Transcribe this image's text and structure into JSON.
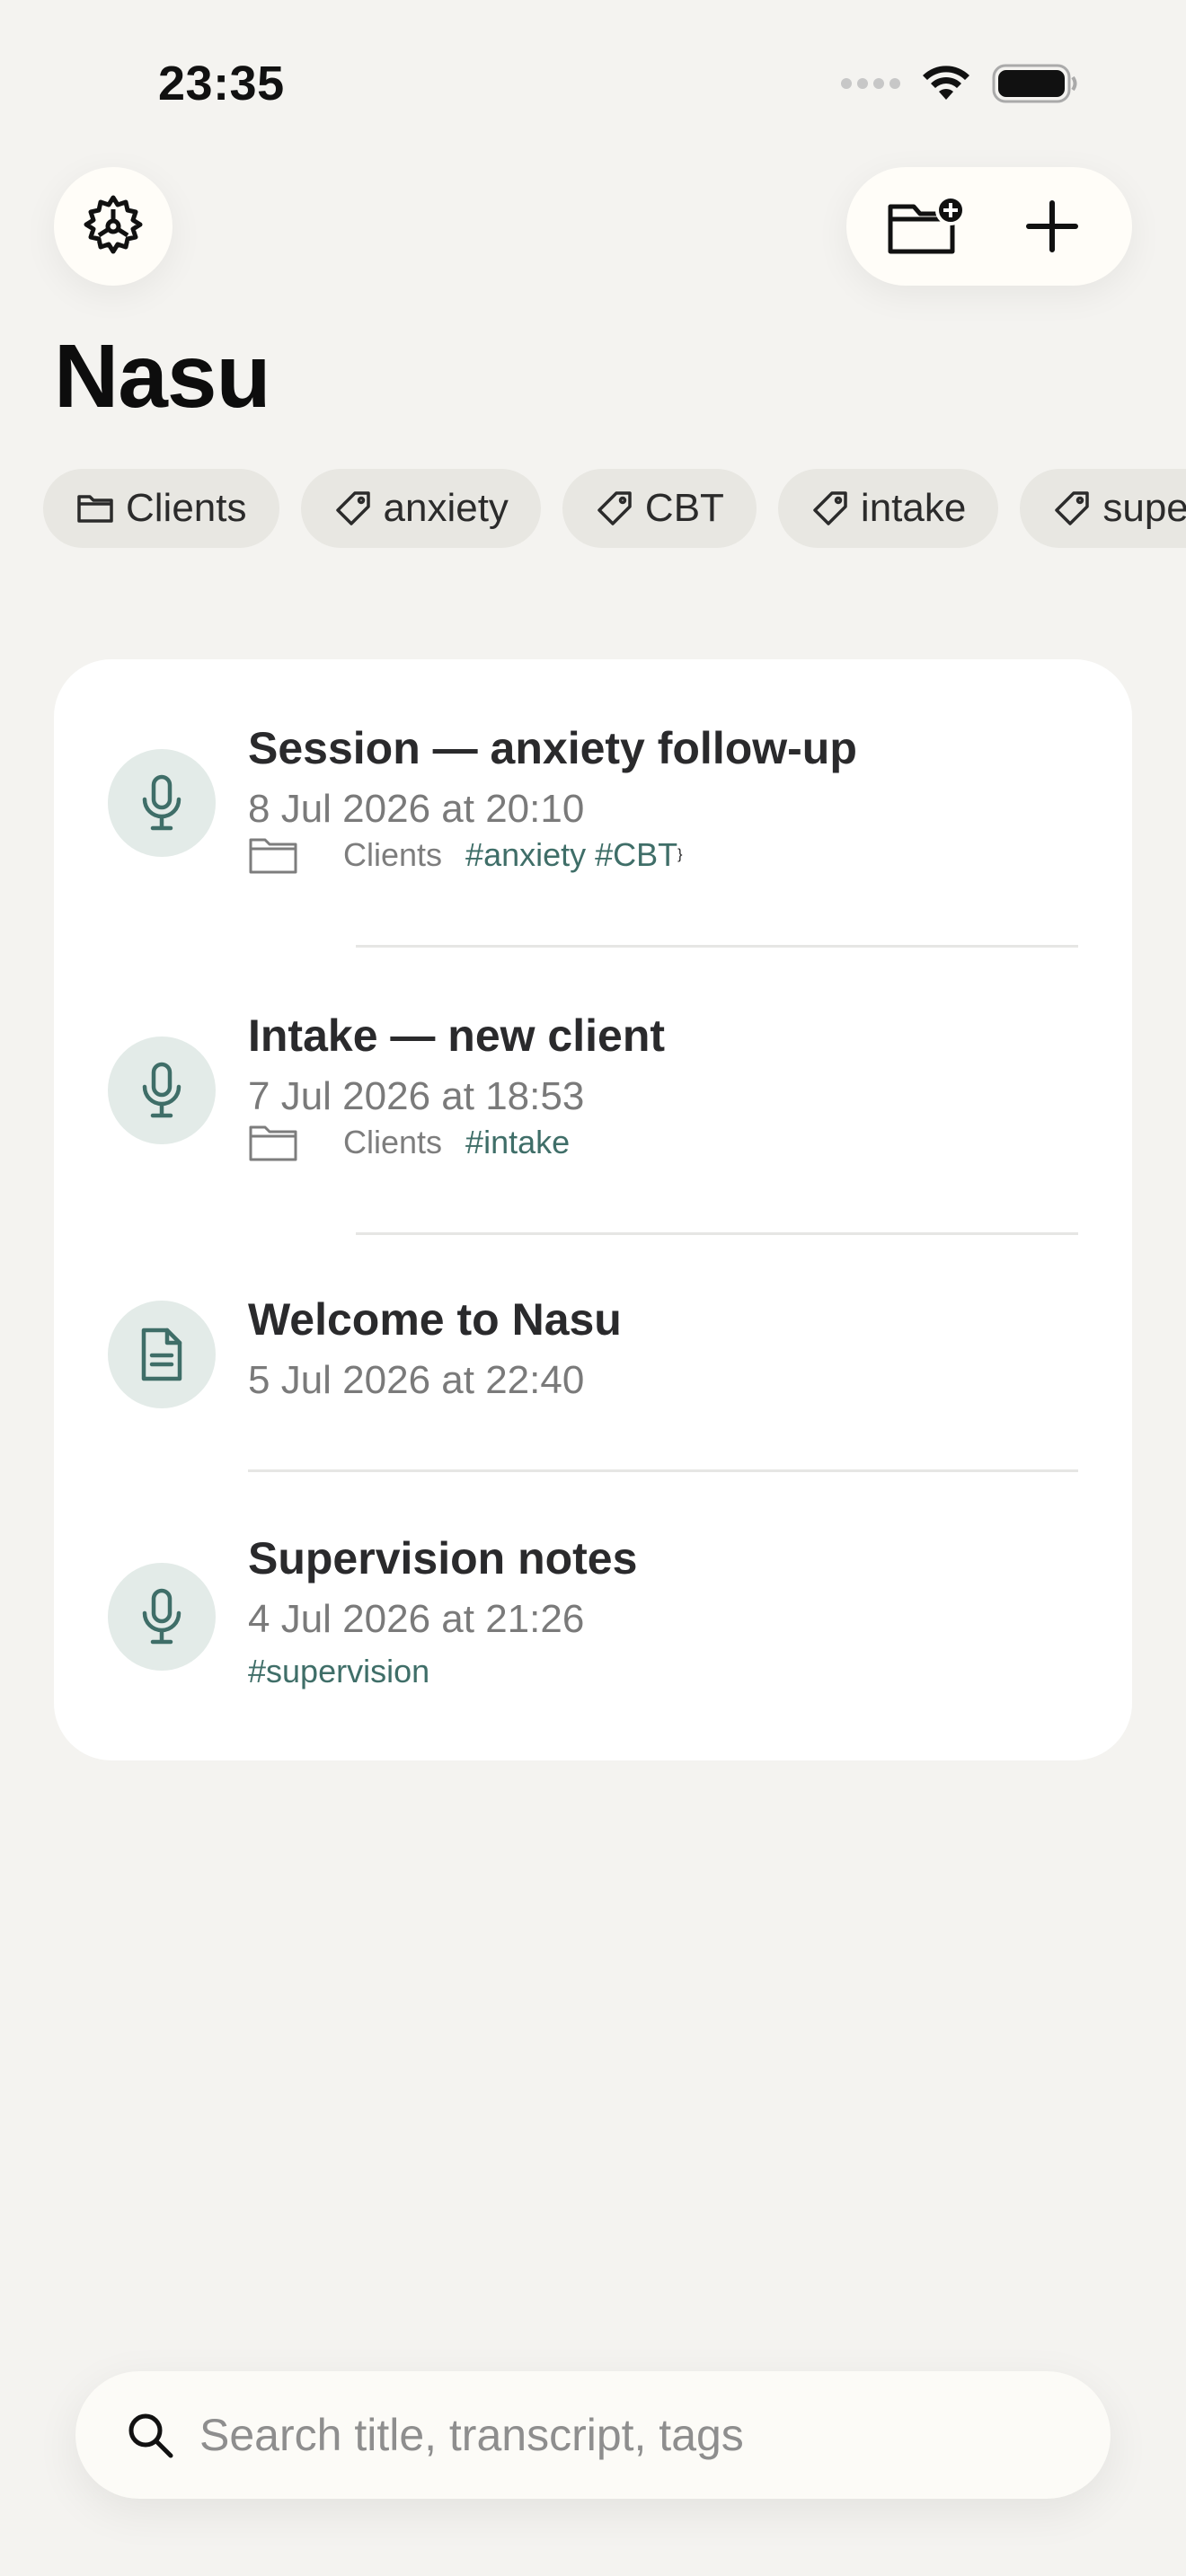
{
  "status_bar": {
    "time": "23:35"
  },
  "header": {
    "settings_icon": "gear-icon",
    "new_folder_icon": "folder-plus-icon",
    "add_icon": "plus-icon",
    "title": "Nasu"
  },
  "filters": [
    {
      "icon": "folder-icon",
      "label": "Clients"
    },
    {
      "icon": "tag-icon",
      "label": "anxiety"
    },
    {
      "icon": "tag-icon",
      "label": "CBT"
    },
    {
      "icon": "tag-icon",
      "label": "intake"
    },
    {
      "icon": "tag-icon",
      "label": "supervision"
    }
  ],
  "notes": [
    {
      "icon": "microphone-icon",
      "title": "Session — anxiety follow-up",
      "date": "8 Jul 2026 at 20:10",
      "folder": "Clients",
      "tags": "#anxiety #CBT"
    },
    {
      "icon": "microphone-icon",
      "title": "Intake — new client",
      "date": "7 Jul 2026 at 18:53",
      "folder": "Clients",
      "tags": "#intake"
    },
    {
      "icon": "document-icon",
      "title": "Welcome to Nasu",
      "date": "5 Jul 2026 at 22:40"
    },
    {
      "icon": "microphone-icon",
      "title": "Supervision notes",
      "date": "4 Jul 2026 at 21:26",
      "tags": "#supervision"
    }
  ],
  "search": {
    "placeholder": "Search title, transcript, tags"
  },
  "colors": {
    "background": "#f4f3f0",
    "card": "#ffffff",
    "accent": "#3f6e68",
    "chip": "#e8e7e2"
  }
}
